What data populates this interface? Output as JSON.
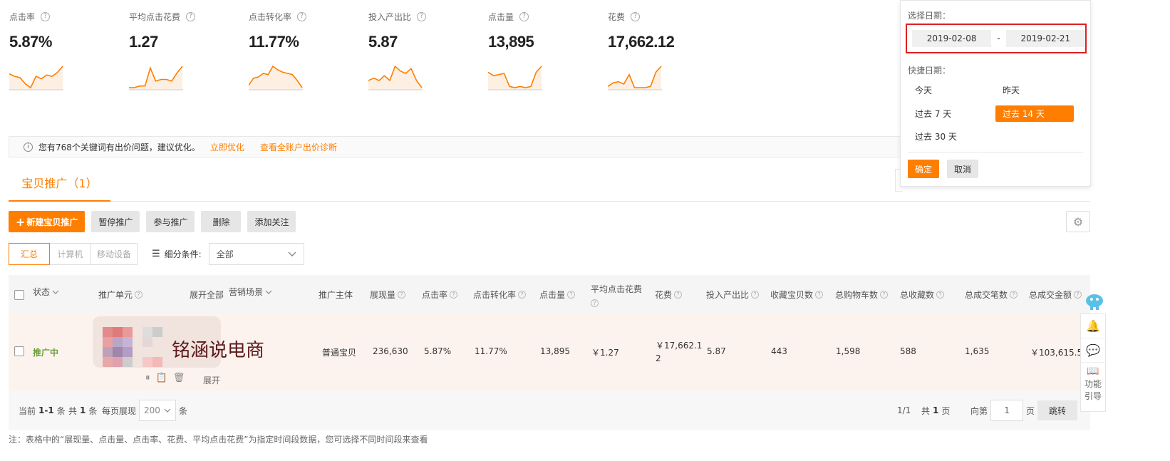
{
  "metrics": [
    {
      "label": "点击率",
      "value": "5.87%",
      "trend": [
        12,
        10,
        9,
        4,
        1,
        10,
        8,
        11,
        10,
        13,
        18
      ]
    },
    {
      "label": "平均点击花费",
      "value": "1.27",
      "trend": [
        2,
        2,
        3,
        3,
        14,
        6,
        7,
        7,
        6,
        11,
        15
      ]
    },
    {
      "label": "点击转化率",
      "value": "11.77%",
      "trend": [
        4,
        10,
        11,
        14,
        13,
        20,
        17,
        15,
        14,
        13,
        8,
        2
      ]
    },
    {
      "label": "投入产出比",
      "value": "5.87",
      "trend": [
        8,
        9,
        8,
        10,
        8,
        14,
        12,
        11,
        13,
        8,
        5
      ]
    },
    {
      "label": "点击量",
      "value": "13,895",
      "trend": [
        14,
        11,
        12,
        13,
        2,
        1,
        2,
        1,
        2,
        14,
        19
      ]
    },
    {
      "label": "花费",
      "value": "17,662.12",
      "trend": [
        2,
        5,
        6,
        4,
        12,
        1,
        1,
        1,
        2,
        14,
        19
      ]
    }
  ],
  "notice": {
    "icon": "info-icon",
    "text": "您有768个关键词有出价问题，建议优化。",
    "link1": "立即优化",
    "link2": "查看全账户出价诊断"
  },
  "tab": {
    "label": "宝贝推广（1）"
  },
  "toolbar": {
    "new_label": "新建宝贝推广",
    "pause_label": "暂停推广",
    "join_label": "参与推广",
    "delete_label": "删除",
    "follow_label": "添加关注"
  },
  "filters": {
    "segments": [
      "汇总",
      "计算机",
      "移动设备"
    ],
    "condition_label": "细分条件:",
    "condition_value": "全部"
  },
  "table": {
    "headers": {
      "status": "状态",
      "unit": "推广单元",
      "expand_all": "展开全部",
      "scene": "营销场景",
      "subject": "推广主体",
      "impressions": "展现量",
      "ctr": "点击率",
      "cvr": "点击转化率",
      "clicks": "点击量",
      "cpc": "平均点击花费",
      "cost": "花费",
      "roi": "投入产出比",
      "fav_items": "收藏宝贝数",
      "cart": "总购物车数",
      "fav_total": "总收藏数",
      "orders": "总成交笔数",
      "gmv": "总成交金额"
    },
    "row": {
      "status": "推广中",
      "watermark": "铭涵说电商",
      "expand": "展开",
      "subject": "普通宝贝",
      "impressions": "236,630",
      "ctr": "5.87%",
      "cvr": "11.77%",
      "clicks": "13,895",
      "cpc": "￥1.27",
      "cost": "￥17,662.12",
      "roi": "5.87",
      "fav_items": "443",
      "cart": "1,598",
      "fav_total": "588",
      "orders": "1,635",
      "gmv": "￥103,615.50"
    }
  },
  "pager": {
    "current_prefix": "当前",
    "current_range": "1-1",
    "current_suffix": "条",
    "total_prefix": "共",
    "total_count": "1",
    "total_suffix": "条",
    "per_page_label": "每页展现",
    "per_page_value": "200",
    "per_page_suffix": "条",
    "page_ratio": "1/1",
    "page_total_prefix": "共",
    "page_total": "1",
    "page_total_suffix": "页",
    "goto_label": "向第",
    "goto_value": "1",
    "goto_suffix": "页",
    "jump_label": "跳转"
  },
  "footnote": "注：表格中的“展现量、点击量、点击率、花费、平均点击花费”为指定时间段数据，您可选择不同时间段来查看",
  "datepicker": {
    "select_label": "选择日期：",
    "start": "2019-02-08",
    "separator": "-",
    "end": "2019-02-21",
    "quick_label": "快捷日期：",
    "options": [
      "今天",
      "昨天",
      "过去 7 天",
      "过去 14 天",
      "过去 30 天"
    ],
    "ok_label": "确定",
    "cancel_label": "取消"
  },
  "dock": {
    "guide_label": "功能引导"
  },
  "colors": {
    "accent": "#ff7e00",
    "highlight": "#e02020",
    "status_on": "#6aa03a",
    "row_bg": "#fdf3ee"
  }
}
